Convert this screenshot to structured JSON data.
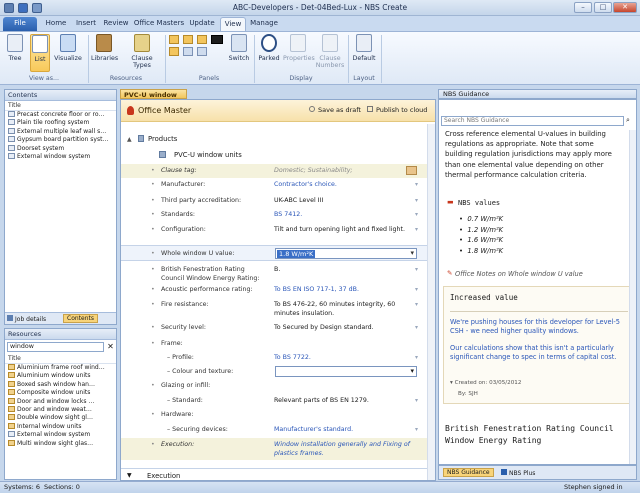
{
  "window": {
    "title": "ABC-Developers - Det-04Bed-Lux - NBS Create",
    "min": "–",
    "max": "□",
    "close": "✕"
  },
  "menu": {
    "file": "File",
    "tabs": [
      "Home",
      "Insert",
      "Review",
      "Office Masters",
      "Update",
      "View",
      "Manage"
    ]
  },
  "ribbon": {
    "buttons": {
      "tree": "Tree",
      "list": "List",
      "visualize": "Visualize",
      "libraries": "Libraries",
      "clause_types": "Clause Types",
      "switch": "Switch",
      "parked": "Parked",
      "properties": "Properties",
      "clause_numbers": "Clause Numbers",
      "default": "Default"
    },
    "groups": {
      "view_as": "View as...",
      "resources": "Resources",
      "panels": "Panels",
      "display": "Display",
      "layout": "Layout"
    }
  },
  "contents": {
    "title": "Contents",
    "col": "Title",
    "items": [
      "Precast concrete floor or ro…",
      "Plain tile roofing system",
      "External multiple leaf wall s…",
      "Gypsum board partition syst…",
      "Doorset system",
      "External window system"
    ],
    "tabs": [
      "Job details",
      "Contents"
    ]
  },
  "resources": {
    "title": "Resources",
    "search": "window",
    "col": "Title",
    "items": [
      "Aluminium frame roof wind…",
      "Aluminium window units",
      "Boxed sash window han…",
      "Composite window units",
      "Door and window locks …",
      "Door and window weat…",
      "Double window sight gl…",
      "Internal window units",
      "External window system",
      "Multi window sight glas…"
    ]
  },
  "doc": {
    "tab": "PVC-U window units",
    "office_master": "Office Master",
    "save_draft": "Save as draft",
    "publish": "Publish to cloud",
    "products": "Products",
    "product": "PVC-U window units",
    "fields": [
      {
        "label": "Clause tag:",
        "value": "Domestic; Sustainability;"
      },
      {
        "label": "Manufacturer:",
        "value": "Contractor's choice."
      },
      {
        "label": "Third party accreditation:",
        "value": "UK-ABC Level III"
      },
      {
        "label": "Standards:",
        "value": "BS 7412."
      },
      {
        "label": "Configuration:",
        "value": "Tilt and turn opening light and fixed light."
      },
      {
        "label": "Whole window U value:",
        "value": "1.8 W/m²K"
      },
      {
        "label": "British Fenestration Rating Council Window Energy Rating:",
        "value": "B."
      },
      {
        "label": "Acoustic performance rating:",
        "value": "To BS EN ISO 717-1, 37 dB."
      },
      {
        "label": "Fire resistance:",
        "value": "To BS 476-22, 60 minutes integrity, 60 minutes insulation."
      },
      {
        "label": "Security level:",
        "value": "To Secured by Design standard."
      },
      {
        "label": "Frame:",
        "value": ""
      },
      {
        "label": "– Profile:",
        "value": "To BS 7722."
      },
      {
        "label": "– Colour and texture:",
        "value": ""
      },
      {
        "label": "Glazing or infill:",
        "value": ""
      },
      {
        "label": "– Standard:",
        "value": "Relevant parts of BS EN 1279."
      },
      {
        "label": "Hardware:",
        "value": ""
      },
      {
        "label": "– Securing devices:",
        "value": "Manufacturer's standard."
      },
      {
        "label": "Execution:",
        "value": "Window installation generally and Fixing of plastics frames."
      }
    ],
    "execution": "Execution"
  },
  "guidance": {
    "title": "NBS Guidance",
    "search": "Search NBS Guidance",
    "text": "Cross reference elemental U-values in building regulations as appropriate. Note that some building regulation jurisdictions may apply more than one elemental value depending on other thermal performance calculation criteria.",
    "values_title": "NBS values",
    "values": [
      "0.7 W/m²K",
      "1.2 W/m²K",
      "1.6 W/m²K",
      "1.8 W/m²K"
    ],
    "office_notes": "Office Notes on Whole window U value",
    "note_title": "Increased value",
    "note1": "We're pushing houses for this developer for Level-5 CSH - we need higher quality windows.",
    "note2": "Our calculations show that this isn't a particularly significant change to spec in terms of capital cost.",
    "created": "Created on: 03/05/2012",
    "by": "By: SJH",
    "bfrc": "British Fenestration Rating Council Window Energy Rating",
    "tabs": [
      "NBS Guidance",
      "NBS Plus"
    ]
  },
  "status": {
    "systems": "Systems: 6",
    "sections": "Sections: 0",
    "user": "Stephen signed in"
  },
  "colors": {
    "accent": "#2a5fad",
    "office": "#f7e1aa",
    "link": "#2a56b8"
  }
}
